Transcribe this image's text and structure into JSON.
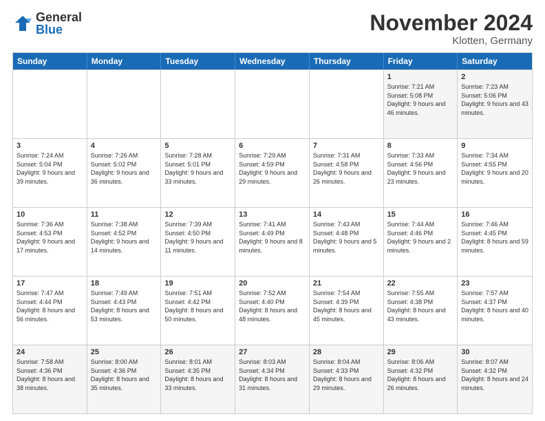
{
  "logo": {
    "general": "General",
    "blue": "Blue"
  },
  "title": "November 2024",
  "location": "Klotten, Germany",
  "header": {
    "days": [
      "Sunday",
      "Monday",
      "Tuesday",
      "Wednesday",
      "Thursday",
      "Friday",
      "Saturday"
    ]
  },
  "rows": [
    [
      {
        "day": "",
        "info": ""
      },
      {
        "day": "",
        "info": ""
      },
      {
        "day": "",
        "info": ""
      },
      {
        "day": "",
        "info": ""
      },
      {
        "day": "",
        "info": ""
      },
      {
        "day": "1",
        "info": "Sunrise: 7:21 AM\nSunset: 5:08 PM\nDaylight: 9 hours and 46 minutes."
      },
      {
        "day": "2",
        "info": "Sunrise: 7:23 AM\nSunset: 5:06 PM\nDaylight: 9 hours and 43 minutes."
      }
    ],
    [
      {
        "day": "3",
        "info": "Sunrise: 7:24 AM\nSunset: 5:04 PM\nDaylight: 9 hours and 39 minutes."
      },
      {
        "day": "4",
        "info": "Sunrise: 7:26 AM\nSunset: 5:02 PM\nDaylight: 9 hours and 36 minutes."
      },
      {
        "day": "5",
        "info": "Sunrise: 7:28 AM\nSunset: 5:01 PM\nDaylight: 9 hours and 33 minutes."
      },
      {
        "day": "6",
        "info": "Sunrise: 7:29 AM\nSunset: 4:59 PM\nDaylight: 9 hours and 29 minutes."
      },
      {
        "day": "7",
        "info": "Sunrise: 7:31 AM\nSunset: 4:58 PM\nDaylight: 9 hours and 26 minutes."
      },
      {
        "day": "8",
        "info": "Sunrise: 7:33 AM\nSunset: 4:56 PM\nDaylight: 9 hours and 23 minutes."
      },
      {
        "day": "9",
        "info": "Sunrise: 7:34 AM\nSunset: 4:55 PM\nDaylight: 9 hours and 20 minutes."
      }
    ],
    [
      {
        "day": "10",
        "info": "Sunrise: 7:36 AM\nSunset: 4:53 PM\nDaylight: 9 hours and 17 minutes."
      },
      {
        "day": "11",
        "info": "Sunrise: 7:38 AM\nSunset: 4:52 PM\nDaylight: 9 hours and 14 minutes."
      },
      {
        "day": "12",
        "info": "Sunrise: 7:39 AM\nSunset: 4:50 PM\nDaylight: 9 hours and 11 minutes."
      },
      {
        "day": "13",
        "info": "Sunrise: 7:41 AM\nSunset: 4:49 PM\nDaylight: 9 hours and 8 minutes."
      },
      {
        "day": "14",
        "info": "Sunrise: 7:43 AM\nSunset: 4:48 PM\nDaylight: 9 hours and 5 minutes."
      },
      {
        "day": "15",
        "info": "Sunrise: 7:44 AM\nSunset: 4:46 PM\nDaylight: 9 hours and 2 minutes."
      },
      {
        "day": "16",
        "info": "Sunrise: 7:46 AM\nSunset: 4:45 PM\nDaylight: 8 hours and 59 minutes."
      }
    ],
    [
      {
        "day": "17",
        "info": "Sunrise: 7:47 AM\nSunset: 4:44 PM\nDaylight: 8 hours and 56 minutes."
      },
      {
        "day": "18",
        "info": "Sunrise: 7:49 AM\nSunset: 4:43 PM\nDaylight: 8 hours and 53 minutes."
      },
      {
        "day": "19",
        "info": "Sunrise: 7:51 AM\nSunset: 4:42 PM\nDaylight: 8 hours and 50 minutes."
      },
      {
        "day": "20",
        "info": "Sunrise: 7:52 AM\nSunset: 4:40 PM\nDaylight: 8 hours and 48 minutes."
      },
      {
        "day": "21",
        "info": "Sunrise: 7:54 AM\nSunset: 4:39 PM\nDaylight: 8 hours and 45 minutes."
      },
      {
        "day": "22",
        "info": "Sunrise: 7:55 AM\nSunset: 4:38 PM\nDaylight: 8 hours and 43 minutes."
      },
      {
        "day": "23",
        "info": "Sunrise: 7:57 AM\nSunset: 4:37 PM\nDaylight: 8 hours and 40 minutes."
      }
    ],
    [
      {
        "day": "24",
        "info": "Sunrise: 7:58 AM\nSunset: 4:36 PM\nDaylight: 8 hours and 38 minutes."
      },
      {
        "day": "25",
        "info": "Sunrise: 8:00 AM\nSunset: 4:36 PM\nDaylight: 8 hours and 35 minutes."
      },
      {
        "day": "26",
        "info": "Sunrise: 8:01 AM\nSunset: 4:35 PM\nDaylight: 8 hours and 33 minutes."
      },
      {
        "day": "27",
        "info": "Sunrise: 8:03 AM\nSunset: 4:34 PM\nDaylight: 8 hours and 31 minutes."
      },
      {
        "day": "28",
        "info": "Sunrise: 8:04 AM\nSunset: 4:33 PM\nDaylight: 8 hours and 29 minutes."
      },
      {
        "day": "29",
        "info": "Sunrise: 8:06 AM\nSunset: 4:32 PM\nDaylight: 8 hours and 26 minutes."
      },
      {
        "day": "30",
        "info": "Sunrise: 8:07 AM\nSunset: 4:32 PM\nDaylight: 8 hours and 24 minutes."
      }
    ]
  ]
}
